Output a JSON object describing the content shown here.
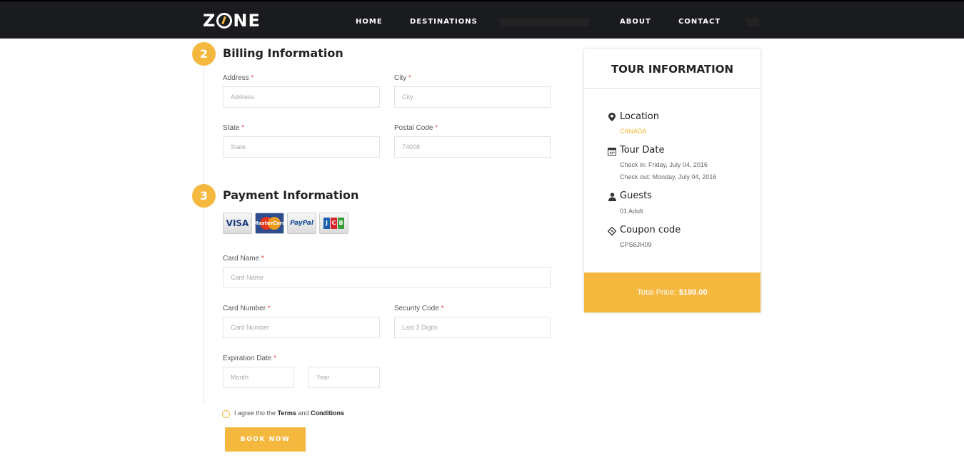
{
  "header": {
    "logo_left": "Z",
    "logo_right": "NE",
    "nav": [
      "HOME",
      "DESTINATIONS",
      "ABOUT",
      "CONTACT"
    ]
  },
  "billing": {
    "step": "2",
    "title": "Billing Information",
    "address_label": "Address",
    "address_placeholder": "Address",
    "city_label": "City",
    "city_placeholder": "City",
    "state_label": "State",
    "state_placeholder": "State",
    "postal_label": "Postal Code",
    "postal_placeholder": "74008"
  },
  "payment": {
    "step": "3",
    "title": "Payment Information",
    "cards": [
      "VISA",
      "MasterCard",
      "PayPal",
      "JCB"
    ],
    "card_name_label": "Card Name",
    "card_name_placeholder": "Card Name",
    "card_number_label": "Card Number",
    "card_number_placeholder": "Card Number",
    "security_label": "Security Code",
    "security_placeholder": "Last 3 Digits",
    "expiration_label": "Expiration Date",
    "month_placeholder": "Month",
    "year_placeholder": "Year"
  },
  "required_mark": "*",
  "terms": {
    "prefix": "I agree tho the",
    "terms": "Terms",
    "and": "and",
    "conditions": "Conditions"
  },
  "book_button": "BOOK NOW",
  "tour": {
    "title": "TOUR INFORMATION",
    "location_label": "Location",
    "location_value": "CANADA",
    "date_label": "Tour Date",
    "check_in": "Check in: Friday, July 04, 2016",
    "check_out": "Check out: Monday, July 04, 2016",
    "guests_label": "Guests",
    "guests_value": "01 Adult",
    "coupon_label": "Coupon code",
    "coupon_value": "CPS6JH09",
    "total_label": "Total Price:",
    "total_value": "$199.00"
  },
  "colors": {
    "accent": "#f4b83e",
    "header": "#1a1b1f",
    "required": "#e04b4b"
  },
  "icons": [
    "map-marker-icon",
    "calendar-icon",
    "user-icon",
    "ticket-icon"
  ]
}
